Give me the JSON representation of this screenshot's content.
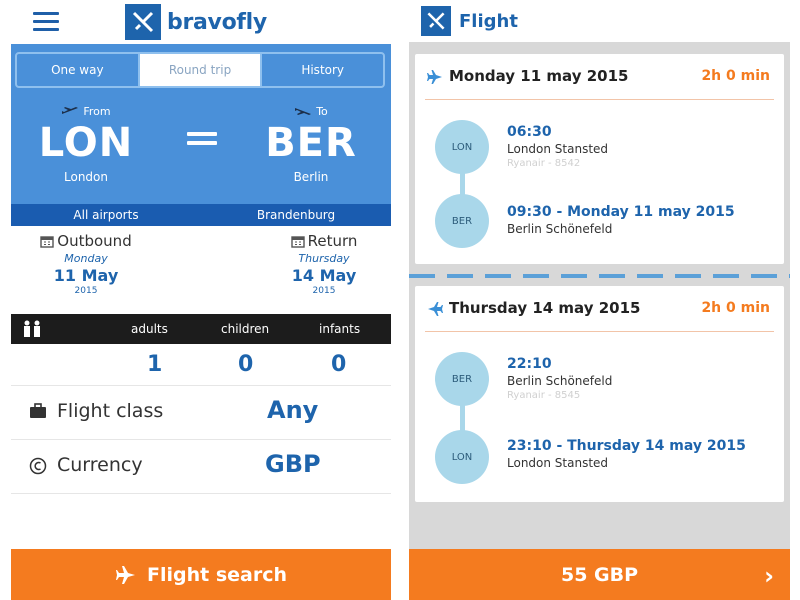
{
  "colors": {
    "brand_blue": "#1e64ac",
    "panel_blue": "#4a90d9",
    "accent_orange": "#f47b1f",
    "bubble": "#a9d7ea"
  },
  "left": {
    "header": {
      "logo_text": "bravofly"
    },
    "tabs": [
      {
        "label": "One way",
        "active": false
      },
      {
        "label": "Round trip",
        "active": true
      },
      {
        "label": "History",
        "active": false
      }
    ],
    "route": {
      "from_label": "From",
      "from_code": "LON",
      "from_city": "London",
      "from_airports": "All airports",
      "to_label": "To",
      "to_code": "BER",
      "to_city": "Berlin",
      "to_airports": "Brandenburg"
    },
    "dates": {
      "outbound_label": "Outbound",
      "outbound_day": "Monday",
      "outbound_date": "11 May",
      "outbound_year": "2015",
      "return_label": "Return",
      "return_day": "Thursday",
      "return_date": "14 May",
      "return_year": "2015"
    },
    "passengers": {
      "adults_label": "adults",
      "children_label": "children",
      "infants_label": "infants",
      "adults": "1",
      "children": "0",
      "infants": "0"
    },
    "flight_class": {
      "label": "Flight class",
      "value": "Any"
    },
    "currency": {
      "label": "Currency",
      "value": "GBP"
    },
    "search_button": "Flight search"
  },
  "right": {
    "header": {
      "title": "Flight"
    },
    "outbound": {
      "date": "Monday 11 may 2015",
      "duration": "2h 0 min",
      "dep_code": "LON",
      "dep_time": "06:30",
      "dep_airport": "London Stansted",
      "carrier": "Ryanair - 8542",
      "arr_code": "BER",
      "arr_time": "09:30 - Monday 11 may 2015",
      "arr_airport": "Berlin Schönefeld"
    },
    "return": {
      "date": "Thursday 14 may 2015",
      "duration": "2h 0 min",
      "dep_code": "BER",
      "dep_time": "22:10",
      "dep_airport": "Berlin Schönefeld",
      "carrier": "Ryanair - 8545",
      "arr_code": "LON",
      "arr_time": "23:10 - Thursday 14 may 2015",
      "arr_airport": "London Stansted"
    },
    "price_button": "55 GBP"
  }
}
